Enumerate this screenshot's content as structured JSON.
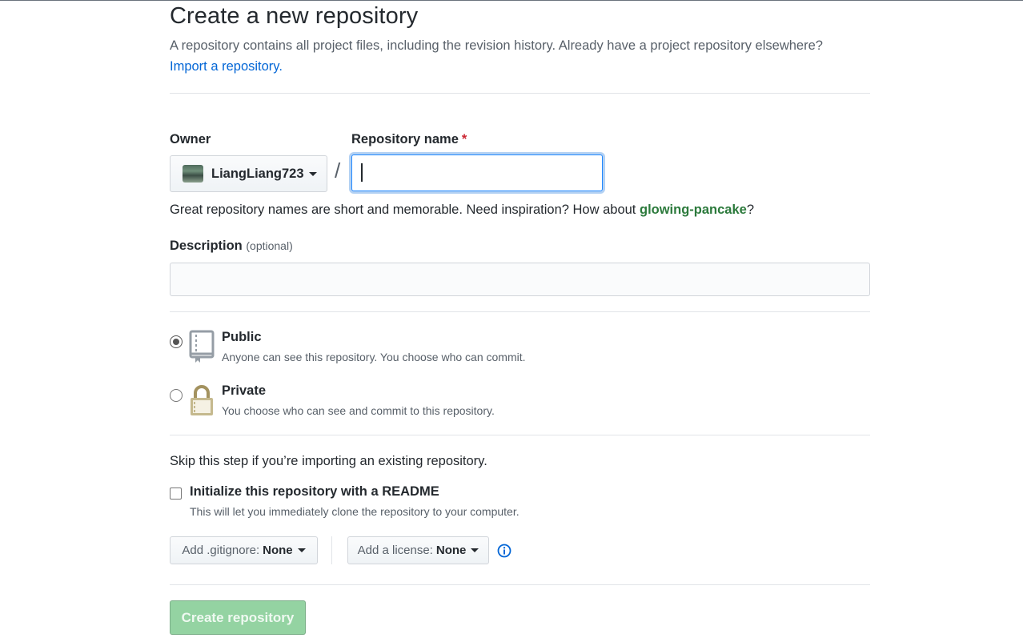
{
  "header": {
    "title": "Create a new repository",
    "description": "A repository contains all project files, including the revision history. Already have a project repository elsewhere?",
    "import_link": "Import a repository."
  },
  "owner": {
    "label": "Owner",
    "value": "LiangLiang723",
    "separator": "/"
  },
  "repo_name": {
    "label": "Repository name",
    "required_mark": "*",
    "value": "",
    "hint_prefix": "Great repository names are short and memorable. Need inspiration? How about",
    "suggestion": "glowing-pancake",
    "hint_suffix": "?"
  },
  "description": {
    "label": "Description",
    "optional": "(optional)",
    "value": ""
  },
  "visibility": {
    "public": {
      "title": "Public",
      "note": "Anyone can see this repository. You choose who can commit.",
      "checked": true
    },
    "private": {
      "title": "Private",
      "note": "You choose who can see and commit to this repository.",
      "checked": false
    }
  },
  "init": {
    "skip_text": "Skip this step if you’re importing an existing repository.",
    "readme_label": "Initialize this repository with a README",
    "readme_note": "This will let you immediately clone the repository to your computer.",
    "readme_checked": false,
    "gitignore_label": "Add .gitignore:",
    "gitignore_value": "None",
    "license_label": "Add a license:",
    "license_value": "None"
  },
  "submit": {
    "label": "Create repository"
  },
  "colors": {
    "link": "#0366d6",
    "suggestion": "#2c7a3c",
    "required": "#cb2431",
    "submit_disabled": "#94d3a2"
  }
}
